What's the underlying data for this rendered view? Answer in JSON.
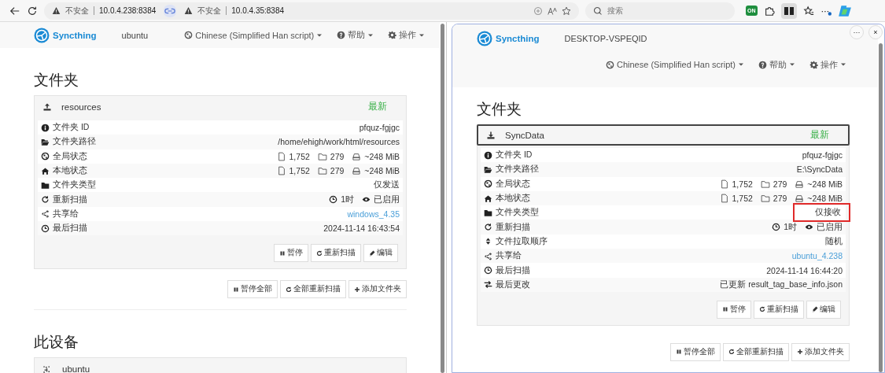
{
  "browser": {
    "addresses": [
      {
        "warning": "不安全",
        "url": "10.0.4.238:8384"
      },
      {
        "warning": "不安全",
        "url": "10.0.4.35:8384"
      }
    ],
    "search": {
      "placeholder": "搜索"
    },
    "extension_badge": "ON"
  },
  "panes": [
    {
      "brand": "Syncthing",
      "device": "ubuntu",
      "nav_wrapped": false,
      "nav": [
        {
          "label": "Chinese (Simplified Han script)"
        },
        {
          "label": "帮助"
        },
        {
          "label": "操作"
        }
      ],
      "folders_heading": "文件夹",
      "folder": {
        "kind": "send",
        "name": "resources",
        "status": "最新",
        "focused": false,
        "rows": [
          {
            "kind": "id",
            "label": "文件夹 ID",
            "value": "pfquz-fgjgc",
            "highlighted": false
          },
          {
            "kind": "path",
            "label": "文件夹路径",
            "value": "/home/ehigh/work/html/resources",
            "highlighted": false
          },
          {
            "kind": "global",
            "label": "全局状态",
            "files": "1,752",
            "dirs": "279",
            "size": "~248 MiB",
            "highlighted": false
          },
          {
            "kind": "local",
            "label": "本地状态",
            "files": "1,752",
            "dirs": "279",
            "size": "~248 MiB",
            "highlighted": false
          },
          {
            "kind": "type",
            "label": "文件夹类型",
            "value": "仅发送",
            "highlighted": false
          },
          {
            "kind": "rescan",
            "label": "重新扫描",
            "interval": "1时",
            "watch": "已启用",
            "highlighted": false
          },
          {
            "kind": "shared",
            "label": "共享给",
            "value": "windows_4.35",
            "highlighted": false
          },
          {
            "kind": "scanned",
            "label": "最后扫描",
            "value": "2024-11-14 16:43:54",
            "highlighted": false
          }
        ],
        "buttons": [
          {
            "label": "暂停"
          },
          {
            "label": "重新扫描"
          },
          {
            "label": "编辑"
          }
        ]
      },
      "folder_actions": [
        {
          "label": "暂停全部"
        },
        {
          "label": "全部重新扫描"
        },
        {
          "label": "添加文件夹"
        }
      ],
      "device_heading": "此设备",
      "device_panel": {
        "name": "ubuntu"
      }
    },
    {
      "window_controls": [
        "···",
        "×"
      ],
      "brand": "Syncthing",
      "device": "DESKTOP-VSPEQID",
      "nav_wrapped": true,
      "nav": [
        {
          "label": "Chinese (Simplified Han script)"
        },
        {
          "label": "帮助"
        },
        {
          "label": "操作"
        }
      ],
      "folders_heading": "文件夹",
      "folder": {
        "kind": "receive",
        "name": "SyncData",
        "status": "最新",
        "focused": true,
        "rows": [
          {
            "kind": "id",
            "label": "文件夹 ID",
            "value": "pfquz-fgjgc",
            "highlighted": false
          },
          {
            "kind": "path",
            "label": "文件夹路径",
            "value": "E:\\SyncData",
            "highlighted": false
          },
          {
            "kind": "global",
            "label": "全局状态",
            "files": "1,752",
            "dirs": "279",
            "size": "~248 MiB",
            "highlighted": false
          },
          {
            "kind": "local",
            "label": "本地状态",
            "files": "1,752",
            "dirs": "279",
            "size": "~248 MiB",
            "highlighted": false
          },
          {
            "kind": "type",
            "label": "文件夹类型",
            "value": "仅接收",
            "highlighted": true
          },
          {
            "kind": "rescan",
            "label": "重新扫描",
            "interval": "1时",
            "watch": "已启用",
            "highlighted": false
          },
          {
            "kind": "order",
            "label": "文件拉取顺序",
            "value": "随机",
            "highlighted": false
          },
          {
            "kind": "shared",
            "label": "共享给",
            "value": "ubuntu_4.238",
            "highlighted": false
          },
          {
            "kind": "scanned",
            "label": "最后扫描",
            "value": "2024-11-14 16:44:20",
            "highlighted": false
          },
          {
            "kind": "changed",
            "label": "最后更改",
            "value": "已更新 result_tag_base_info.json",
            "highlighted": false
          }
        ],
        "buttons": [
          {
            "label": "暂停"
          },
          {
            "label": "重新扫描"
          },
          {
            "label": "编辑"
          }
        ]
      },
      "folder_actions": [
        {
          "label": "暂停全部"
        },
        {
          "label": "全部重新扫描"
        },
        {
          "label": "添加文件夹"
        }
      ]
    }
  ]
}
